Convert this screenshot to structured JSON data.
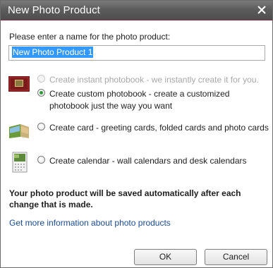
{
  "window": {
    "title": "New Photo Product"
  },
  "form": {
    "prompt": "Please enter a name for the photo product:",
    "name_value": "New Photo Product 1"
  },
  "options": [
    {
      "label": "Create instant photobook - we instantly create it for you.",
      "state": "disabled",
      "icon": "photobook-icon"
    },
    {
      "label_line1": "Create custom photobook - create a customized",
      "label_line2": "photobook just the way you want",
      "state": "checked"
    },
    {
      "label": "Create card - greeting cards, folded cards and photo cards",
      "state": "unchecked",
      "icon": "card-icon"
    },
    {
      "label": "Create calendar - wall calendars and desk calendars",
      "state": "unchecked",
      "icon": "calendar-icon"
    }
  ],
  "info_text": "Your photo product will be saved automatically after each change that is made.",
  "info_link": "Get more information about photo products",
  "buttons": {
    "ok": "OK",
    "cancel": "Cancel"
  },
  "colors": {
    "titlebar": "#5d5d5d",
    "accent_line": "#8a2a4a",
    "selection": "#3399ff",
    "link": "#1c4a8e",
    "radio_checked": "#2b9a3a"
  }
}
